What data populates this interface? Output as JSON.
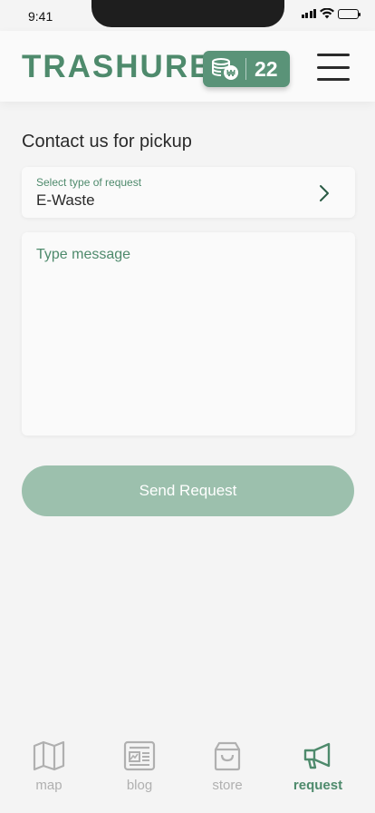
{
  "status_bar": {
    "time": "9:41"
  },
  "header": {
    "logo": "TRASHURE",
    "points": "22"
  },
  "main": {
    "title": "Contact us for pickup",
    "request_type": {
      "label": "Select type of request",
      "value": "E-Waste"
    },
    "message": {
      "placeholder": "Type message",
      "value": ""
    },
    "send_label": "Send Request"
  },
  "bottom_nav": {
    "items": [
      {
        "label": "map",
        "icon": "map-icon",
        "active": false
      },
      {
        "label": "blog",
        "icon": "newspaper-icon",
        "active": false
      },
      {
        "label": "store",
        "icon": "shopping-bag-icon",
        "active": false
      },
      {
        "label": "request",
        "icon": "megaphone-icon",
        "active": true
      }
    ]
  },
  "colors": {
    "brand_green": "#4e8a6c",
    "badge_green": "#5a9378",
    "button_disabled": "#9cc0ad",
    "inactive_gray": "#b0b0b0"
  }
}
